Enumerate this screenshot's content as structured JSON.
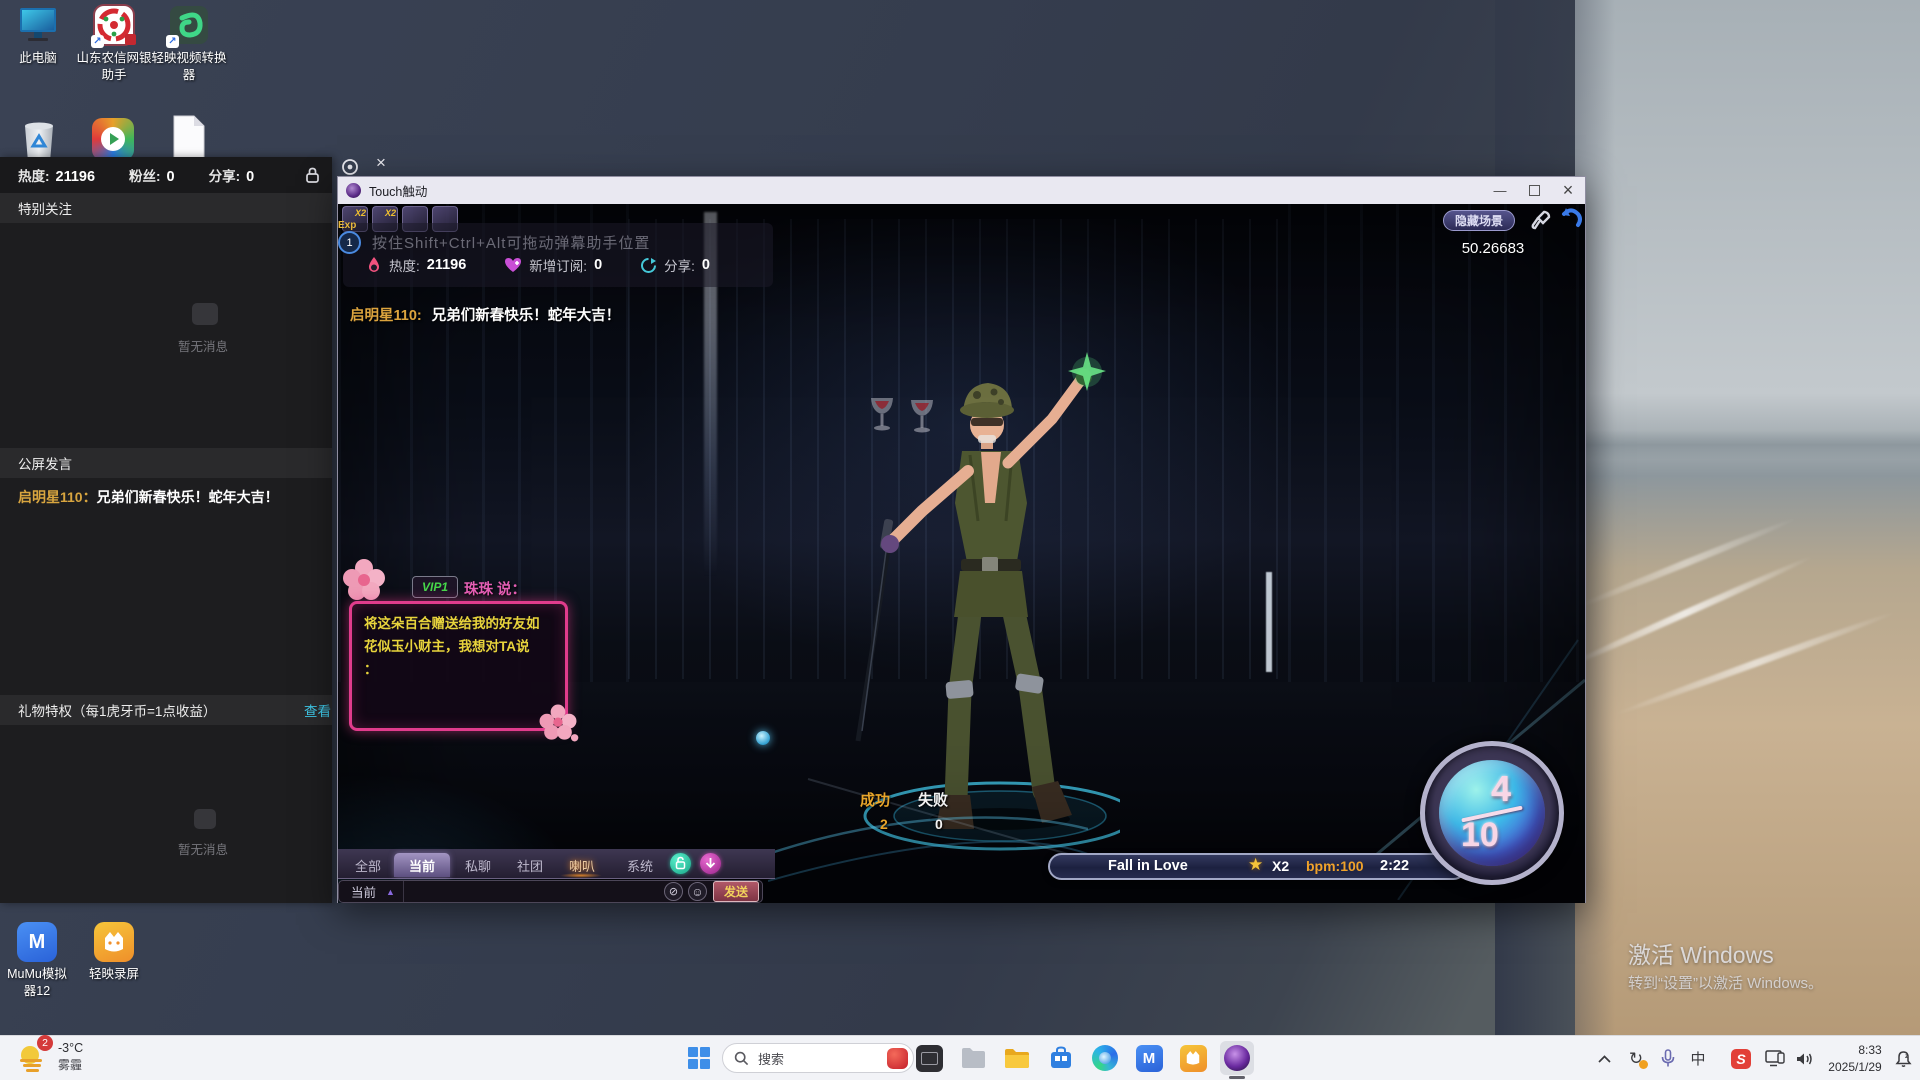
{
  "window": {
    "title": "Touch触动"
  },
  "icons": {
    "minimize": "—",
    "close": "×",
    "panel_close": "×",
    "triangle": "▲",
    "star": "★",
    "clear": "⊘",
    "emoji": "☺",
    "shortcut_arrow": "↗",
    "sync": "↻"
  },
  "panel": {
    "heat_label": "热度:",
    "heat_value": "21196",
    "fans_label": "粉丝:",
    "fans_value": "0",
    "share_label": "分享:",
    "share_value": "0",
    "special_follow": "特别关注",
    "no_msg1": "暂无消息",
    "no_msg2": "暂无消息",
    "public_chat": "公屏发言",
    "gift_priv": "礼物特权（每1虎牙币=1点收益）",
    "view": "查看",
    "msg_user": "启明星110",
    "msg_sep": "：",
    "msg_text": "兄弟们新春快乐！蛇年大吉！"
  },
  "game": {
    "hint": "按住Shift+Ctrl+Alt可拖动弹幕助手位置",
    "heat_label": "热度:",
    "heat_value": "21196",
    "sub_label": "新增订阅:",
    "sub_value": "0",
    "share_label": "分享:",
    "share_value": "0",
    "exp": "Exp",
    "level": "1",
    "buff1": "X2",
    "buff2": "X2",
    "chat_user": "启明星110:",
    "chat_text": "兄弟们新春快乐！蛇年大吉！",
    "vip_badge": "VIP1",
    "vip_speaker": "珠珠 说：",
    "vip_line1": "将这朵百合赠送给我的好友如",
    "vip_line2": "花似玉小财主，我想对TA说",
    "vip_line3": "：",
    "hide_scene": "隐藏场景",
    "coin": "50.26683",
    "success_label": "成功",
    "success_value": "2",
    "fail_label": "失败",
    "fail_value": "0",
    "song_name": "Fall in Love",
    "song_mult": "X2",
    "song_bpm": "bpm:100",
    "song_time": "2:22",
    "round_num": "4",
    "round_den": "10",
    "tabs": [
      "全部",
      "当前",
      "私聊",
      "社团",
      "喇叭",
      "系统"
    ],
    "channel": "当前",
    "send": "发送"
  },
  "desktop": {
    "icon_pc": "此电脑",
    "icon_bank1": "山东农信网银",
    "icon_bank2": "助手",
    "icon_conv1": "轻映视频转换",
    "icon_conv2": "器",
    "icon_mumu1": "MuMu模拟",
    "icon_mumu2": "器12",
    "icon_rec": "轻映录屏",
    "act1": "激活 Windows",
    "act2": "转到“设置”以激活 Windows。"
  },
  "taskbar": {
    "weather_temp": "-3°C",
    "weather_cond": "雾霾",
    "weather_badge": "2",
    "search": "搜索",
    "ime": "中",
    "time": "8:33",
    "date": "2025/1/29"
  }
}
